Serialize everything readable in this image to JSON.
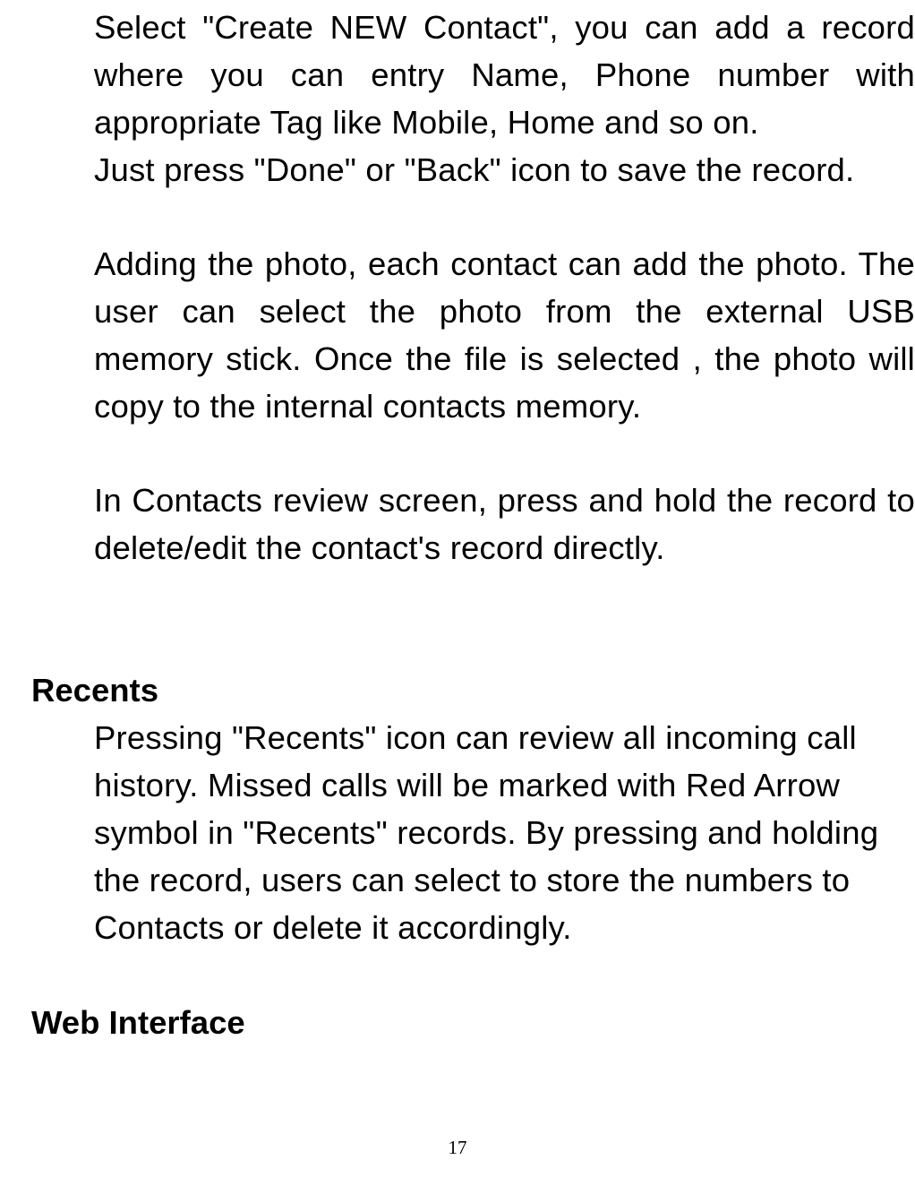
{
  "paragraphs": {
    "p1": "Select \"Create NEW Contact\", you can add a record where you can entry   Name, Phone number with appropriate Tag like Mobile, Home and so on.",
    "p2": "Just press \"Done\" or \"Back\" icon to save the record.",
    "p3": "Adding the photo, each contact can add the photo. The user can select the photo from the external USB memory stick. Once the file is selected , the photo will copy to the internal contacts memory.",
    "p4": "In Contacts review screen, press and hold the record to delete/edit the contact's record directly.",
    "p5": "Pressing \"Recents\" icon can review all incoming call history. Missed calls will be marked with Red Arrow symbol in \"Recents\" records. By pressing and holding the record, users can select to store the numbers to Contacts or delete it accordingly."
  },
  "headings": {
    "recents": "Recents",
    "web_interface": "Web Interface"
  },
  "page_number": "17"
}
